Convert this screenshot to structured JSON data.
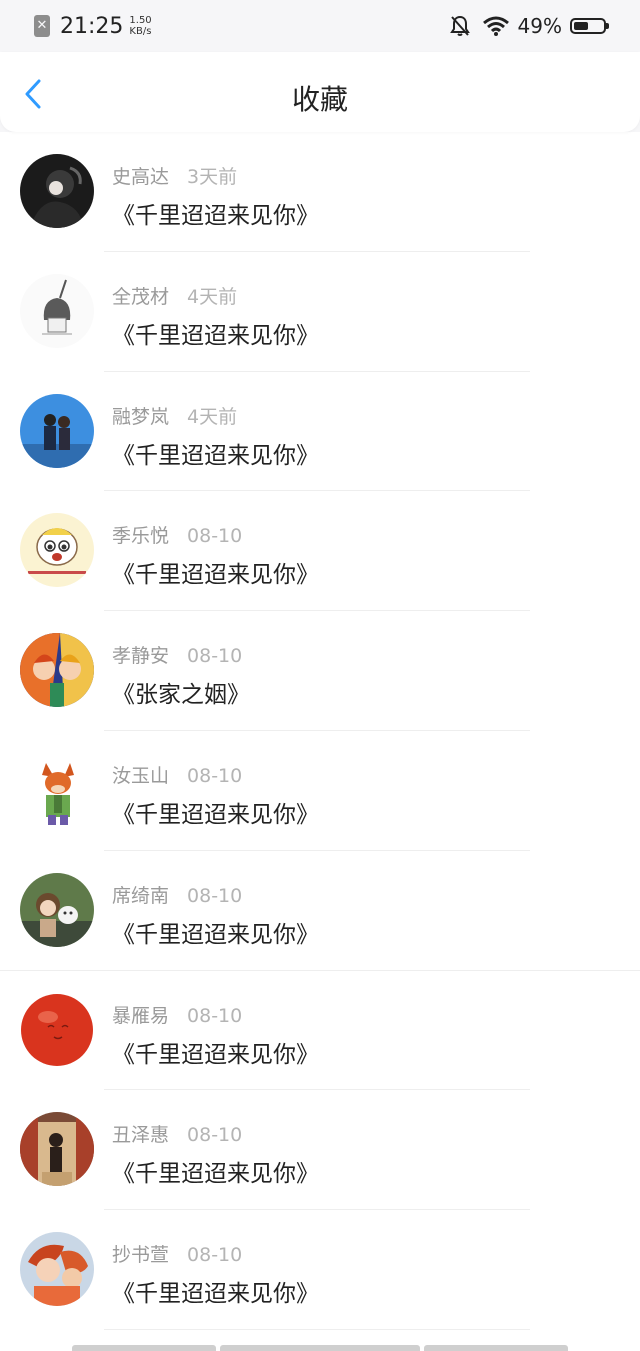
{
  "status_bar": {
    "time": "21:25",
    "speed_value": "1.50",
    "speed_unit": "KB/s",
    "battery_percent": "49%",
    "battery_level": 0.49,
    "icons": [
      "sim-off-icon",
      "bell-off-icon",
      "wifi-icon",
      "battery-icon"
    ]
  },
  "header": {
    "title": "收藏",
    "back_icon": "chevron-left-icon",
    "accent_color": "#2f9bff"
  },
  "favorites": [
    {
      "user": "史高达",
      "time": "3天前",
      "title": "《千里迢迢来见你》"
    },
    {
      "user": "全茂材",
      "time": "4天前",
      "title": "《千里迢迢来见你》"
    },
    {
      "user": "融梦岚",
      "time": "4天前",
      "title": "《千里迢迢来见你》"
    },
    {
      "user": "季乐悦",
      "time": "08-10",
      "title": "《千里迢迢来见你》"
    },
    {
      "user": "孝静安",
      "time": "08-10",
      "title": "《张家之姻》"
    },
    {
      "user": "汝玉山",
      "time": "08-10",
      "title": "《千里迢迢来见你》"
    },
    {
      "user": "席绮南",
      "time": "08-10",
      "title": "《千里迢迢来见你》"
    },
    {
      "user": "暴雁易",
      "time": "08-10",
      "title": "《千里迢迢来见你》"
    },
    {
      "user": "丑泽惠",
      "time": "08-10",
      "title": "《千里迢迢来见你》"
    },
    {
      "user": "抄书萱",
      "time": "08-10",
      "title": "《千里迢迢来见你》"
    }
  ]
}
